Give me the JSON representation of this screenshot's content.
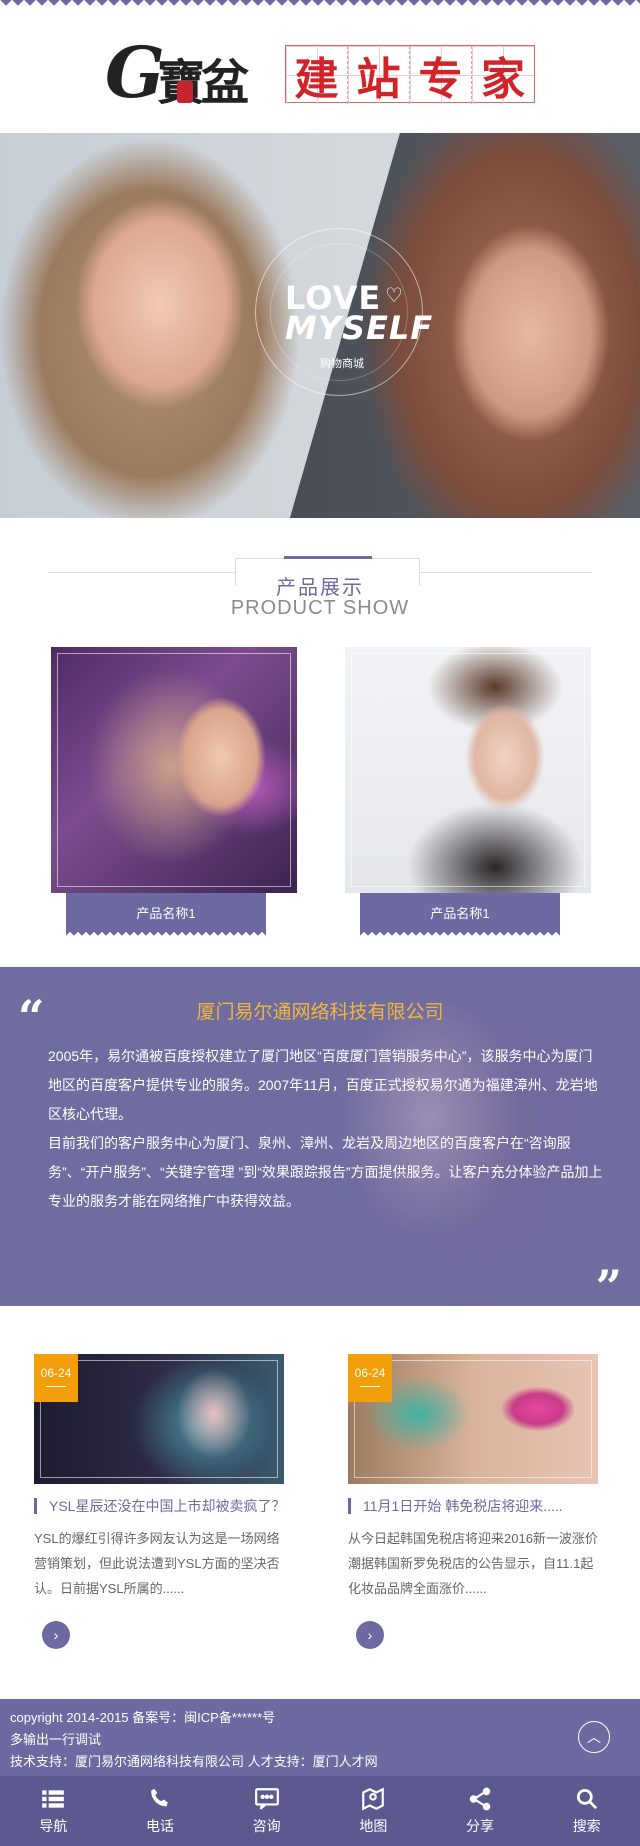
{
  "header": {
    "logo_g": "G",
    "logo_cn": "寶盆",
    "title_chars": [
      "建",
      "站",
      "专",
      "家"
    ]
  },
  "banner": {
    "love": "LOVE",
    "myself": "MYSELF",
    "subtitle": "购物商城"
  },
  "product_section": {
    "title_cn": "产品展示",
    "title_en": "PRODUCT SHOW",
    "items": [
      {
        "name": "产品名称1"
      },
      {
        "name": "产品名称1"
      }
    ]
  },
  "about": {
    "title": "厦门易尔通网络科技有限公司",
    "paragraph1": "2005年，易尔通被百度授权建立了厦门地区“百度厦门营销服务中心”，该服务中心为厦门地区的百度客户提供专业的服务。2007年11月，百度正式授权易尔通为福建漳州、龙岩地区核心代理。",
    "paragraph2": "目前我们的客户服务中心为厦门、泉州、漳州、龙岩及周边地区的百度客户在“咨询服务”、“开户服务”、“关键字管理 ”到“效果跟踪报告”方面提供服务。让客户充分体验产品加上专业的服务才能在网络推广中获得效益。"
  },
  "news": [
    {
      "date": "06-24",
      "title": "YSL星辰还没在中国上市却被卖疯了？",
      "desc": "YSL的爆红引得许多网友认为这是一场网络营销策划，但此说法遭到YSL方面的坚决否认。日前据YSL所属的......"
    },
    {
      "date": "06-24",
      "title": "11月1日开始 韩免税店将迎来.....",
      "desc": "从今日起韩国免税店将迎来2016新一波涨价潮据韩国新罗免税店的公告显示，自11.1起化妆品品牌全面涨价......"
    }
  ],
  "footer": {
    "line1": "copyright 2014-2015 备案号：闽ICP备******号",
    "line2": "多输出一行调试",
    "line3": "技术支持：厦门易尔通网络科技有限公司 人才支持：厦门人才网"
  },
  "bottom_nav": [
    {
      "label": "导航",
      "icon": "menu-icon"
    },
    {
      "label": "电话",
      "icon": "phone-icon"
    },
    {
      "label": "咨询",
      "icon": "chat-icon"
    },
    {
      "label": "地图",
      "icon": "map-icon"
    },
    {
      "label": "分享",
      "icon": "share-icon"
    },
    {
      "label": "搜索",
      "icon": "search-icon"
    }
  ],
  "colors": {
    "primary": "#6c6aa0",
    "accent": "#f39e0b",
    "title_gold": "#f0b73c",
    "logo_red": "#d1232a"
  }
}
